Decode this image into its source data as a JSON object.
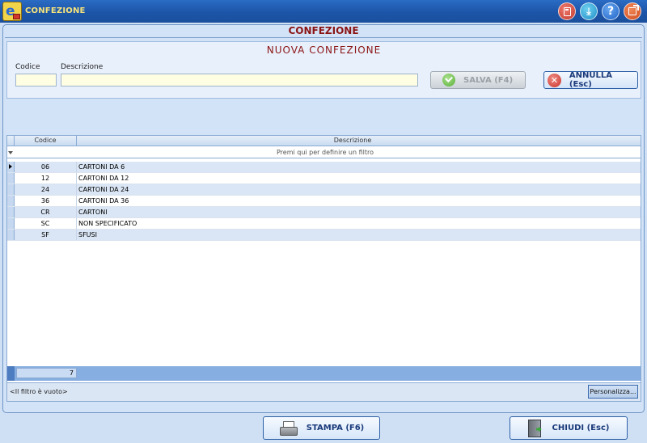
{
  "window": {
    "title": "CONFEZIONE",
    "controls": [
      {
        "name": "calculator-icon",
        "color": "#d3463a"
      },
      {
        "name": "download-icon",
        "color": "#2aa0d8"
      },
      {
        "name": "help-icon",
        "glyph": "?",
        "color": "#2a70d0"
      },
      {
        "name": "exit-icon",
        "color": "#e05a28"
      }
    ]
  },
  "main": {
    "title": "CONFEZIONE"
  },
  "new_panel": {
    "title": "NUOVA CONFEZIONE",
    "codice_label": "Codice",
    "codice_value": "",
    "descrizione_label": "Descrizione",
    "descrizione_value": "",
    "save_label": "SALVA (F4)",
    "cancel_label": "ANNULLA  (Esc)"
  },
  "grid": {
    "columns": [
      "Codice",
      "Descrizione"
    ],
    "filter_hint": "Premi qui per definire un filtro",
    "rows": [
      {
        "codice": "06",
        "descrizione": "CARTONI DA 6"
      },
      {
        "codice": "12",
        "descrizione": "CARTONI DA 12"
      },
      {
        "codice": "24",
        "descrizione": "CARTONI DA 24"
      },
      {
        "codice": "36",
        "descrizione": "CARTONI DA 36"
      },
      {
        "codice": "CR",
        "descrizione": "CARTONI"
      },
      {
        "codice": "SC",
        "descrizione": "NON SPECIFICATO"
      },
      {
        "codice": "SF",
        "descrizione": "SFUSI"
      }
    ],
    "count": "7",
    "filter_status": "<Il filtro è vuoto>",
    "customize_label": "Personalizza..."
  },
  "bottom": {
    "print_label": "STAMPA  (F6)",
    "close_label": "CHIUDI  (Esc)"
  },
  "colors": {
    "titlebar": "#1c55a8",
    "title_text": "#f6e27a",
    "heading": "#8b1414",
    "row_alt": "#dae6f5",
    "input_bg": "#fffde2"
  }
}
